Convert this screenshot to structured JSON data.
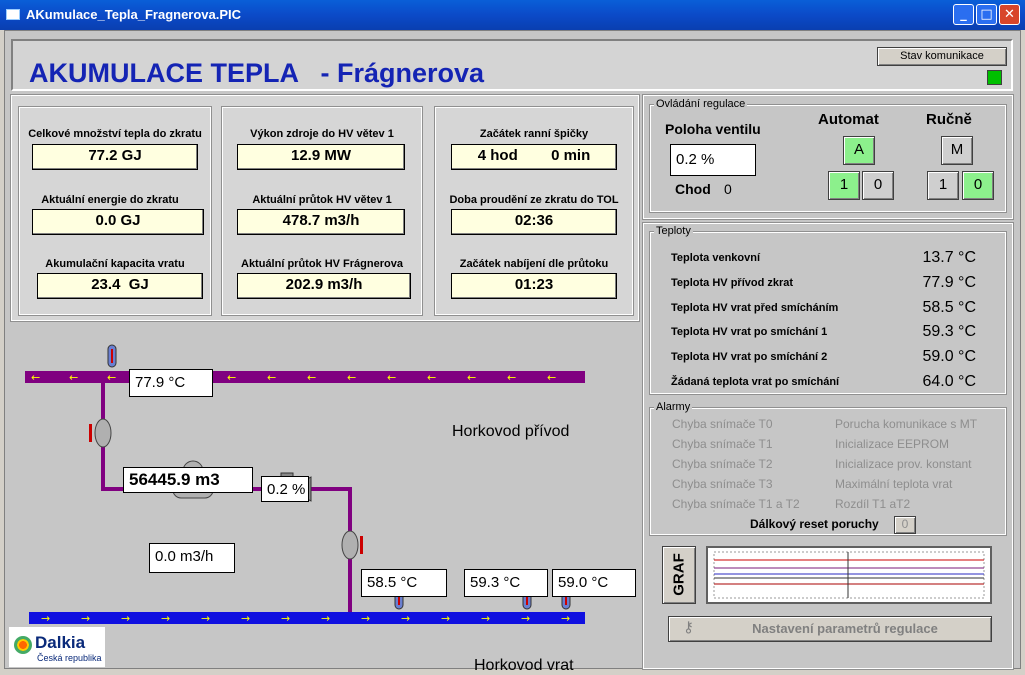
{
  "window": {
    "title": "AKumulace_Tepla_Fragnerova.PIC",
    "minimize": "_",
    "maximize": "□",
    "close": "✕"
  },
  "header": {
    "title": "AKUMULACE TEPLA   - Frágnerova",
    "status_button": "Stav komunikace",
    "status_color": "#00c000"
  },
  "info": {
    "col1": [
      {
        "label": "Celkové množství tepla do zkratu",
        "value": "77.2 GJ"
      },
      {
        "label": "Aktuální energie do zkratu",
        "value": "0.0 GJ"
      },
      {
        "label": "Akumulační kapacita vratu",
        "value": "23.4  GJ"
      }
    ],
    "col2": [
      {
        "label": "Výkon zdroje do HV větev 1",
        "value": "12.9 MW"
      },
      {
        "label": "Aktuální průtok HV větev 1",
        "value": "478.7 m3/h"
      },
      {
        "label": "Aktuální průtok HV Frágnerova",
        "value": "202.9 m3/h"
      }
    ],
    "col3": [
      {
        "label": "Začátek ranní špičky",
        "value": "4 hod        0 min"
      },
      {
        "label": "Doba proudění ze zkratu do TOL",
        "value": "02:36"
      },
      {
        "label": "Začátek nabíjení dle průtoku",
        "value": "01:23"
      }
    ]
  },
  "control": {
    "group_title": "Ovládání regulace",
    "valve_label": "Poloha ventilu",
    "valve_value": "0.2 %",
    "chod_label": "Chod",
    "chod_value": "0",
    "auto_label": "Automat",
    "manual_label": "Ručně",
    "auto_btn": "A",
    "manual_btn": "M",
    "one": "1",
    "zero": "0"
  },
  "temps": {
    "group_title": "Teploty",
    "rows": [
      {
        "label": "Teplota venkovní",
        "value": "13.7 °C"
      },
      {
        "label": "Teplota HV přívod zkrat",
        "value": "77.9 °C"
      },
      {
        "label": "Teplota HV  vrat před smícháním",
        "value": "58.5 °C"
      },
      {
        "label": "Teplota HV vrat po smíchání 1",
        "value": "59.3 °C"
      },
      {
        "label": "Teplota HV vrat po smíchání 2",
        "value": "59.0 °C"
      },
      {
        "label": "Žádaná teplota vrat po smíchání",
        "value": "64.0 °C"
      }
    ]
  },
  "alarms": {
    "group_title": "Alarmy",
    "left": [
      "Chyba snímače T0",
      "Chyba snímače T1",
      "Chyba snímače T2",
      "Chyba snímače T3",
      "Chyba snímače T1 a T2"
    ],
    "right": [
      "Porucha komunikace s MT",
      "Inicializace EEPROM",
      "Inicializace prov. konstant",
      "Maximální teplota vrat",
      "Rozdíl T1 aT2"
    ],
    "reset_label": "Dálkový reset poruchy",
    "reset_value": "0"
  },
  "graph_button": "GRAF",
  "settings_button": "Nastavení parametrů regulace",
  "schematic": {
    "supply_temp": "77.9 °C",
    "volume": "56445.9 m3",
    "valve_pos": "0.2 %",
    "flow": "0.0 m3/h",
    "t_return_before": "58.5 °C",
    "t_return_after1": "59.3 °C",
    "t_return_after2": "59.0 °C",
    "supply_name": "Horkovod přívod",
    "return_name": "Horkovod vrat",
    "supply_color": "#800080",
    "return_color": "#1010e0"
  },
  "logo": {
    "brand": "Dalkia",
    "subtitle": "Česká republika"
  }
}
